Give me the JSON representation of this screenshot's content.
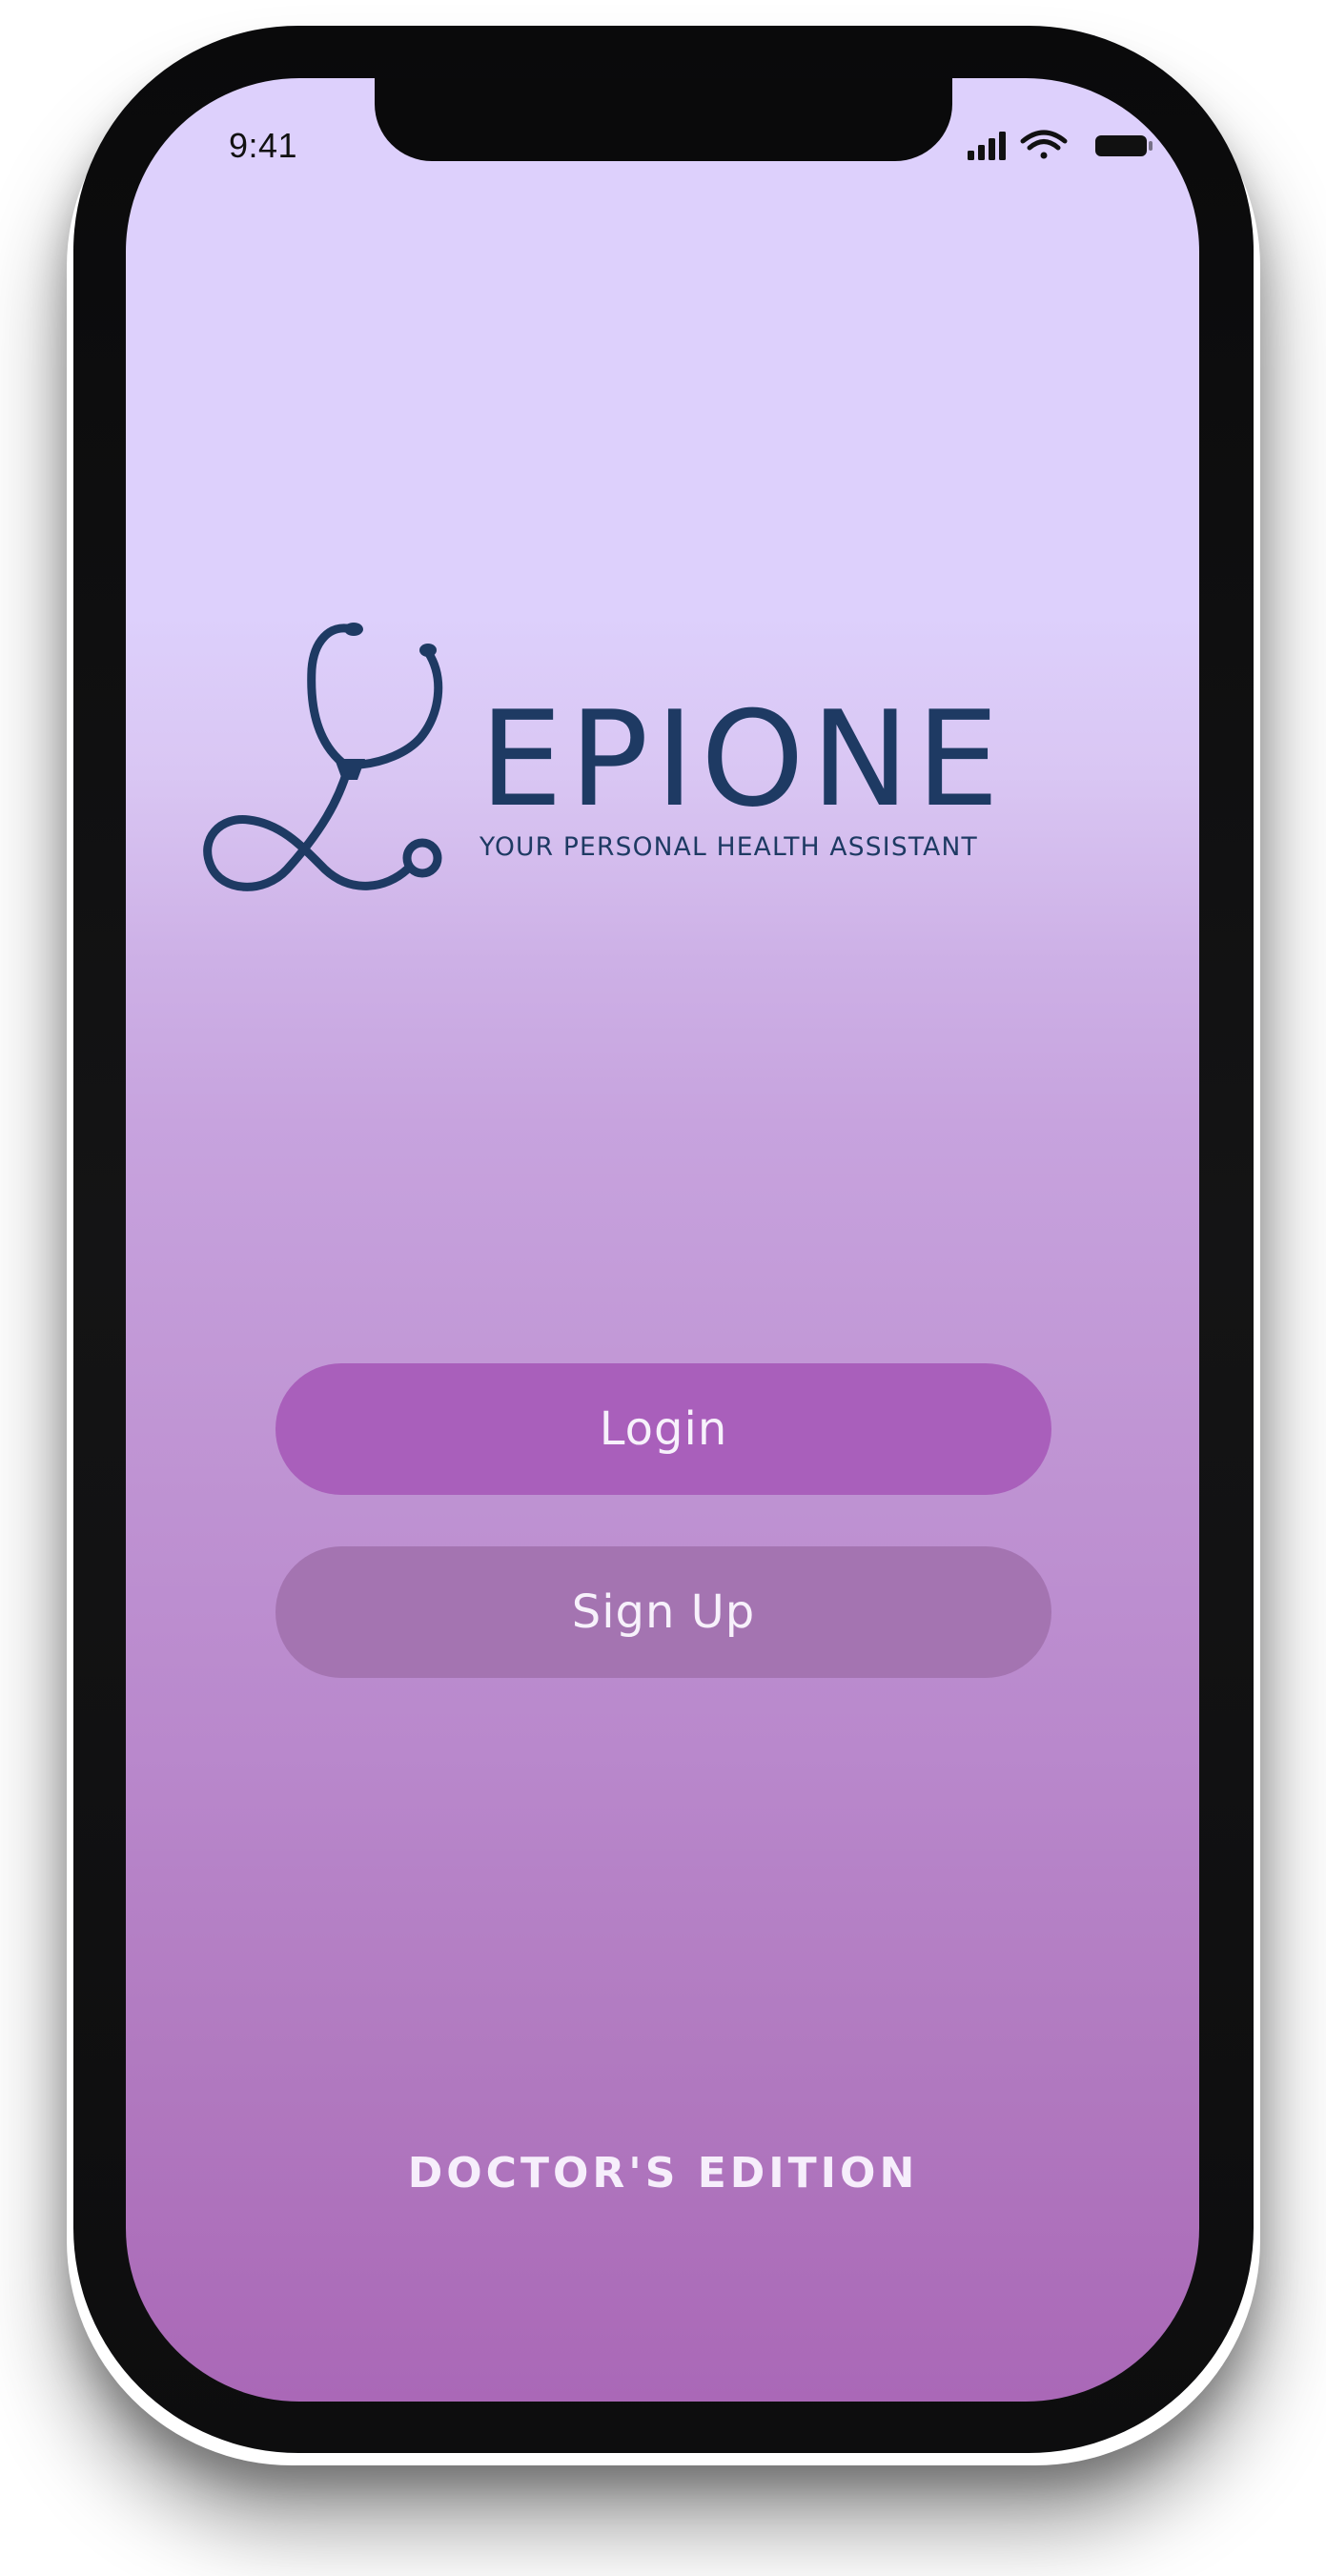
{
  "status_bar": {
    "time": "9:41",
    "icons": [
      "cellular-signal-icon",
      "wifi-icon",
      "battery-icon"
    ]
  },
  "logo": {
    "icon": "stethoscope-icon",
    "brand_name": "EPIONE",
    "tagline": "YOUR PERSONAL HEALTH ASSISTANT"
  },
  "actions": {
    "login_label": "Login",
    "signup_label": "Sign Up"
  },
  "footer": {
    "edition_label": "DOCTOR'S EDITION"
  },
  "colors": {
    "background_top": "#ddd0fc",
    "background_bottom": "#aa68b7",
    "brand": "#1e3a63",
    "login_button": "#a95fbb",
    "signup_button": "#a474b1",
    "button_text": "#f7f1fb"
  }
}
